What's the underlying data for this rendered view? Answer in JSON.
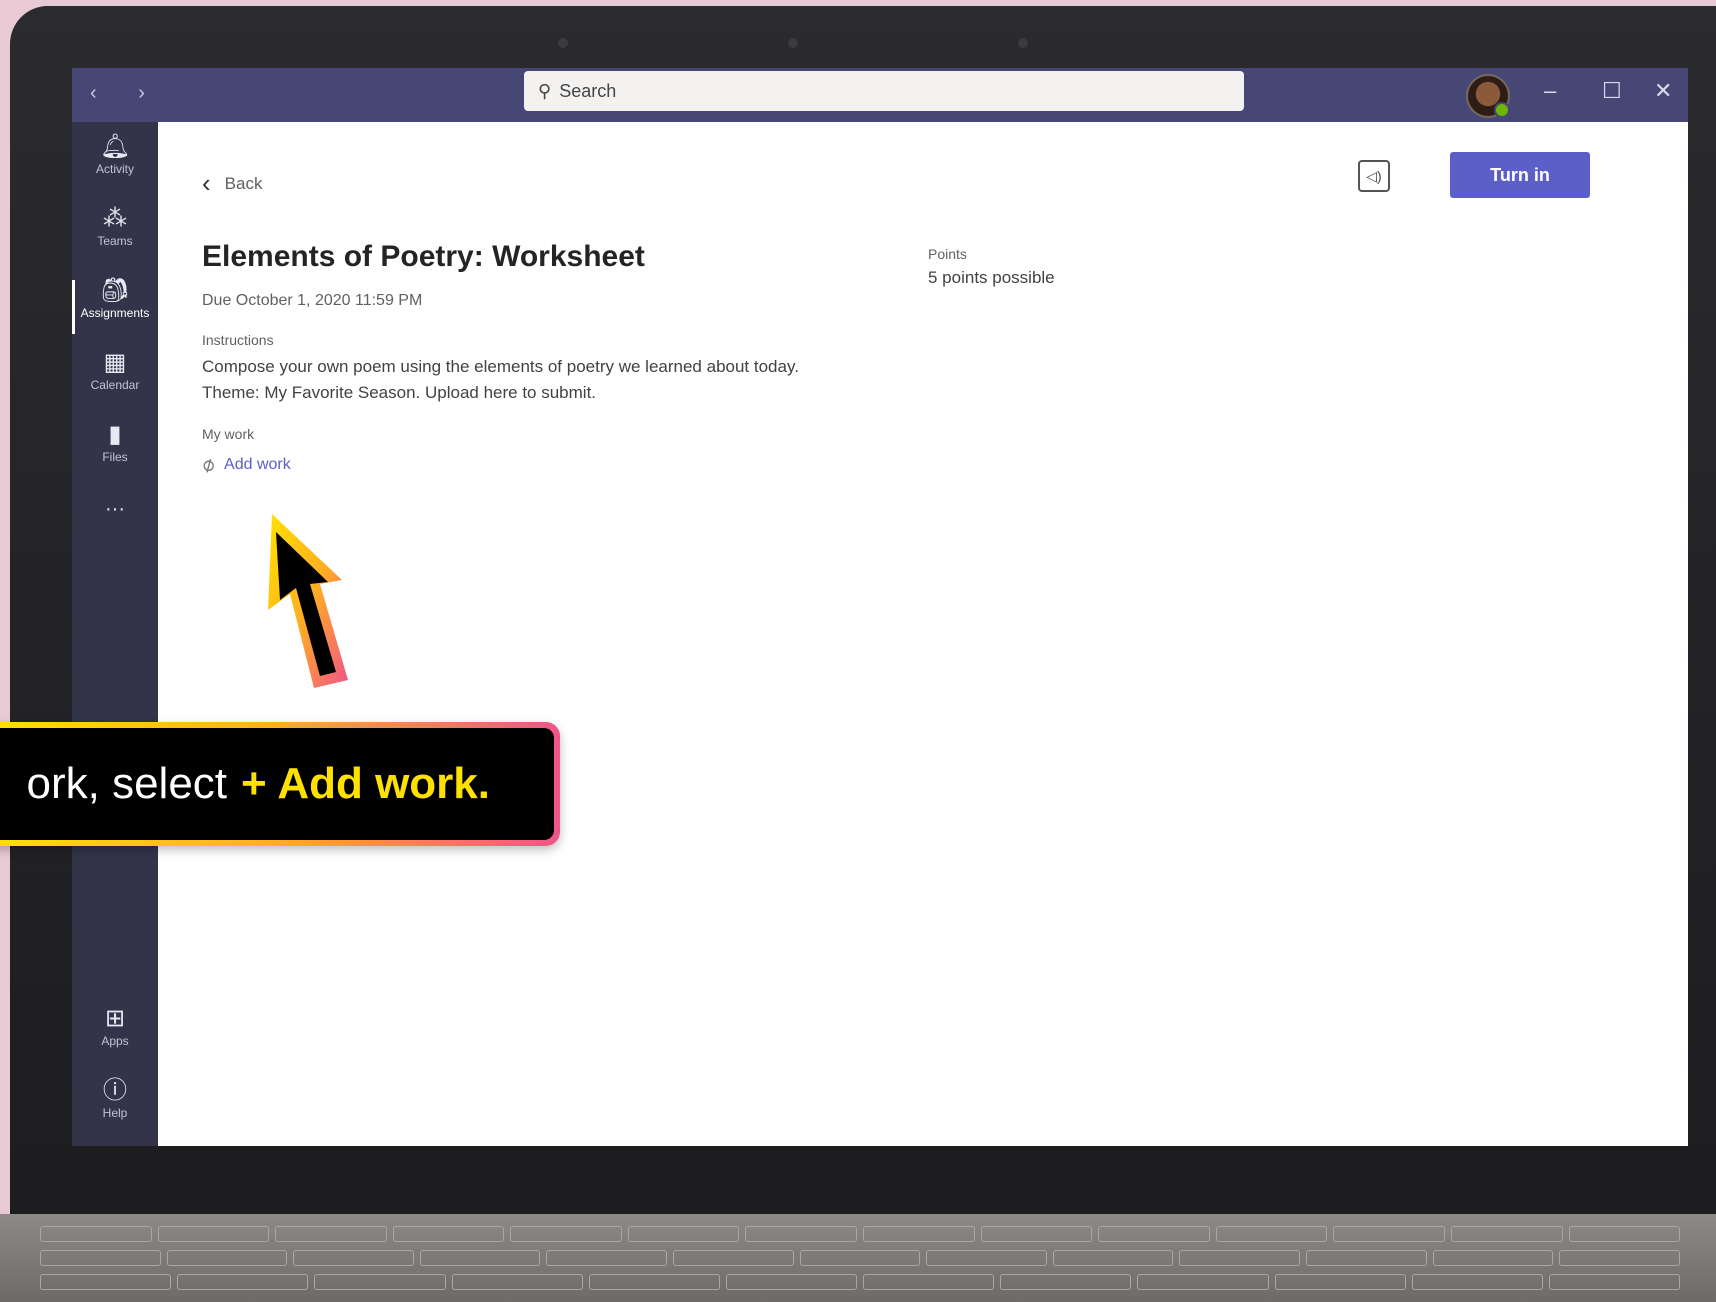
{
  "window": {
    "search_placeholder": "Search"
  },
  "sidebar": {
    "items": [
      {
        "label": "Activity",
        "icon": "bell-icon"
      },
      {
        "label": "Teams",
        "icon": "teams-icon"
      },
      {
        "label": "Assignments",
        "icon": "backpack-icon"
      },
      {
        "label": "Calendar",
        "icon": "calendar-icon"
      },
      {
        "label": "Files",
        "icon": "files-icon"
      },
      {
        "label": "···",
        "icon": "more-icon"
      },
      {
        "label": "Apps",
        "icon": "apps-icon"
      },
      {
        "label": "Help",
        "icon": "help-icon"
      }
    ]
  },
  "assignment": {
    "back_label": "Back",
    "turn_in_label": "Turn in",
    "title": "Elements of Poetry: Worksheet",
    "due": "Due October 1, 2020 11:59 PM",
    "instructions_label": "Instructions",
    "instructions_text_line1": "Compose your own poem using the elements of poetry we learned about today.",
    "instructions_text_line2": "Theme: My Favorite Season. Upload here to submit.",
    "my_work_label": "My work",
    "add_work_label": "Add work",
    "points_label": "Points",
    "points_value": "5 points possible"
  },
  "callout": {
    "text": "ork, select",
    "highlight": "+ Add work."
  },
  "colors": {
    "title_bar": "#464775",
    "sidebar": "#33344a",
    "accent": "#5b5fc7",
    "callout_highlight": "#ffe100"
  }
}
